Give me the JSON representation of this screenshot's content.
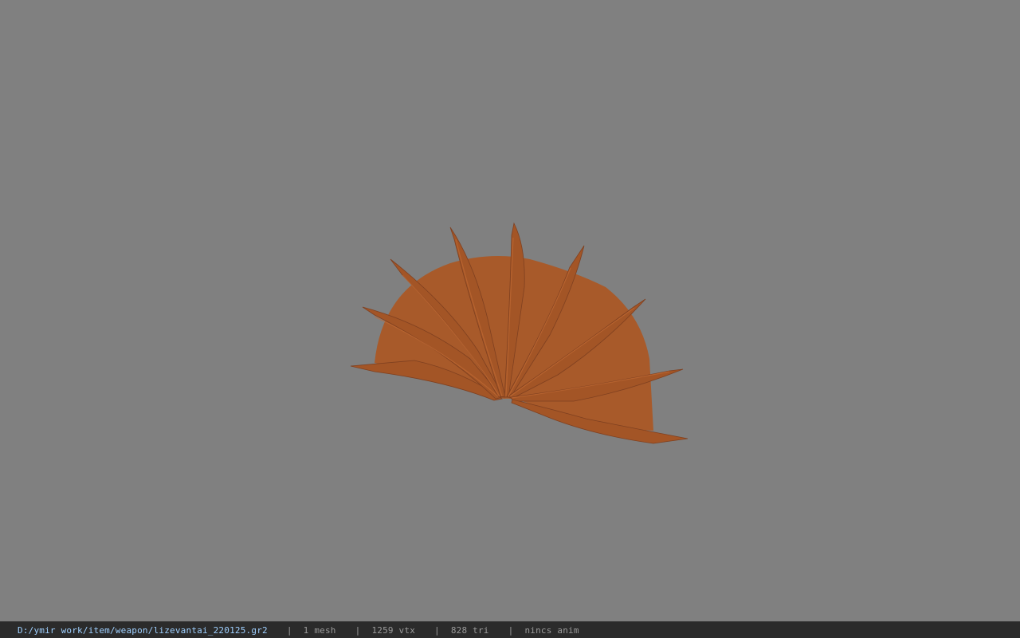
{
  "viewer": {
    "background_color": "#808080",
    "model_color": "#a85a2a",
    "model_shadow_color": "#7f4020"
  },
  "status": {
    "file_path": "D:/ymir work/item/weapon/lizevantai_220125.gr2",
    "separator": "|",
    "mesh_count": "1 mesh",
    "vertex_count": "1259 vtx",
    "triangle_count": "828 tri",
    "anim": "nincs anim"
  }
}
